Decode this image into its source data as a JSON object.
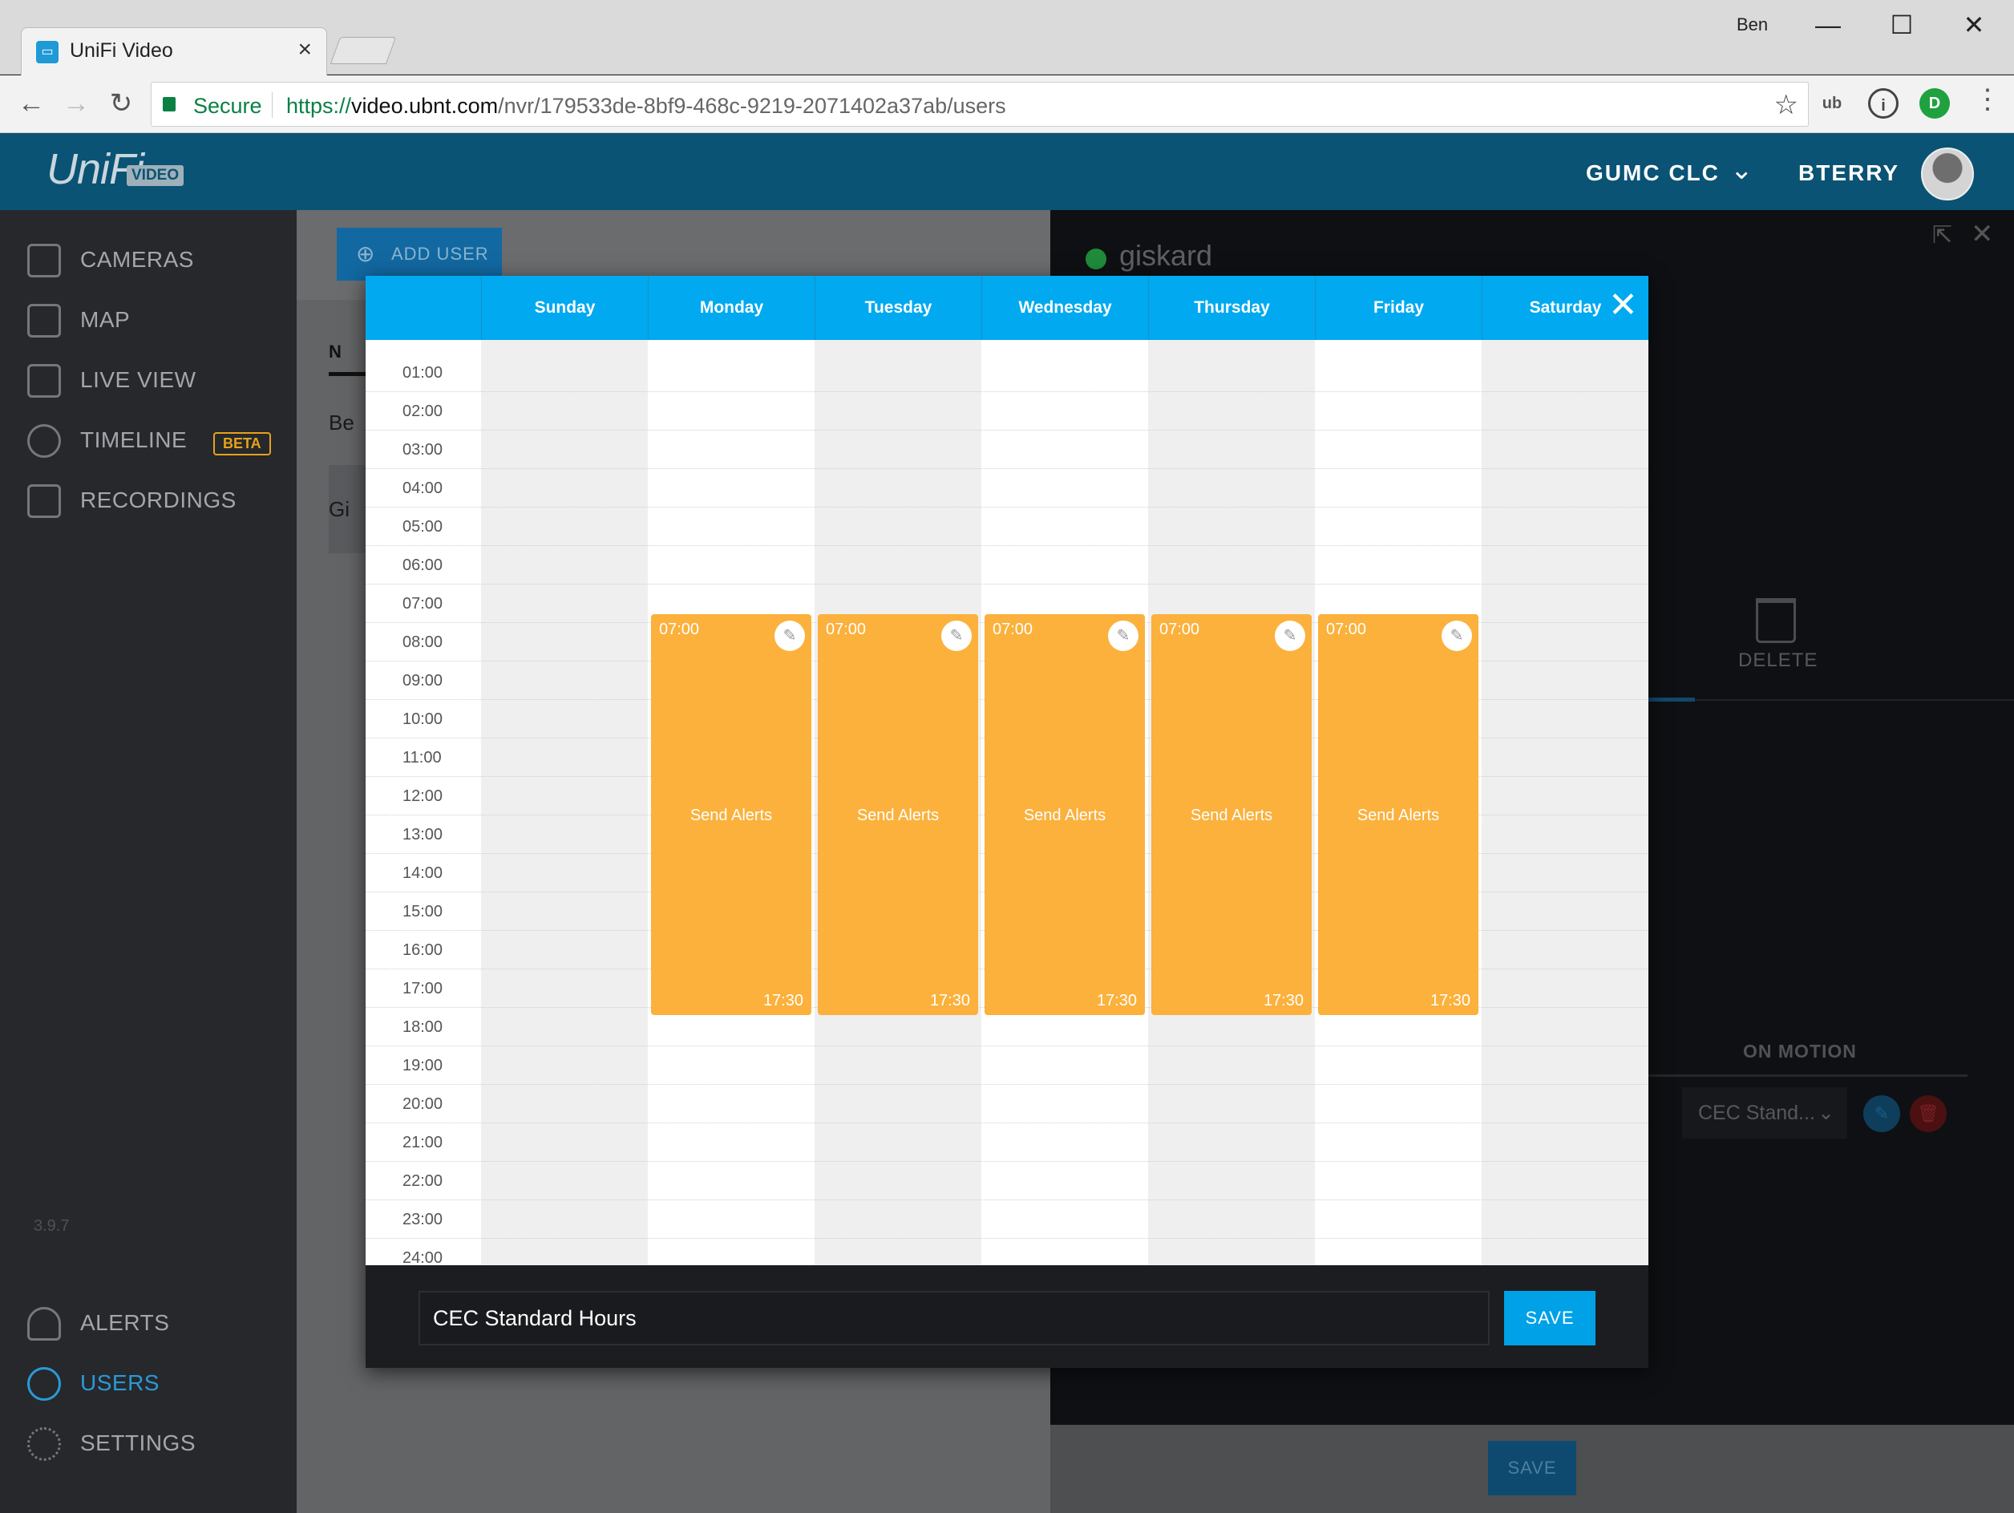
{
  "browser": {
    "tab_title": "UniFi Video",
    "tab_close": "×",
    "profile_name": "Ben",
    "window_controls": {
      "minimize": "—",
      "maximize": "☐",
      "close": "✕"
    },
    "nav": {
      "back": "←",
      "forward": "→",
      "reload": "↻"
    },
    "secure_label": "Secure",
    "url_scheme": "https://",
    "url_host": "video.ubnt.com",
    "url_path": "/nvr/179533de-8bf9-468c-9219-2071402a37ab/users",
    "star": "☆",
    "menu": "⋮",
    "extensions": [
      "ub",
      "i",
      "D"
    ]
  },
  "header": {
    "logo_text": "UniFi",
    "logo_badge": "VIDEO",
    "site_name": "GUMC CLC",
    "site_chevron": "⌄",
    "user_name": "BTERRY"
  },
  "sidebar": {
    "items": [
      {
        "label": "CAMERAS",
        "icon": "camera-icon"
      },
      {
        "label": "MAP",
        "icon": "map-icon"
      },
      {
        "label": "LIVE VIEW",
        "icon": "live-view-icon"
      },
      {
        "label": "TIMELINE",
        "icon": "clock-icon",
        "badge": "BETA"
      },
      {
        "label": "RECORDINGS",
        "icon": "play-icon"
      }
    ],
    "bottom_items": [
      {
        "label": "ALERTS",
        "icon": "bell-icon"
      },
      {
        "label": "USERS",
        "icon": "users-icon",
        "active": true
      },
      {
        "label": "SETTINGS",
        "icon": "gear-icon"
      }
    ],
    "version": "3.9.7"
  },
  "users_list": {
    "add_user_label": "ADD USER",
    "add_icon": "⊕",
    "column_tab": "N",
    "rows": [
      "Be",
      "Gi"
    ]
  },
  "user_panel": {
    "name": "giskard",
    "expand_icon": "⇱",
    "close_icon": "✕",
    "delete_label": "DELETE",
    "on_motion_label": "ON MOTION",
    "schedule_select": "CEC Stand...",
    "select_chevron": "⌄",
    "edit_icon": "✎",
    "trash_icon": "🗑",
    "save_label": "SAVE"
  },
  "schedule_modal": {
    "days": [
      "Sunday",
      "Monday",
      "Tuesday",
      "Wednesday",
      "Thursday",
      "Friday",
      "Saturday"
    ],
    "close_icon": "✕",
    "hours": [
      "01:00",
      "02:00",
      "03:00",
      "04:00",
      "05:00",
      "06:00",
      "07:00",
      "08:00",
      "09:00",
      "10:00",
      "11:00",
      "12:00",
      "13:00",
      "14:00",
      "15:00",
      "16:00",
      "17:00",
      "18:00",
      "19:00",
      "20:00",
      "21:00",
      "22:00",
      "23:00",
      "24:00"
    ],
    "slots": [
      {
        "day": "Monday",
        "start": "07:00",
        "end": "17:30",
        "title": "Send Alerts"
      },
      {
        "day": "Tuesday",
        "start": "07:00",
        "end": "17:30",
        "title": "Send Alerts"
      },
      {
        "day": "Wednesday",
        "start": "07:00",
        "end": "17:30",
        "title": "Send Alerts"
      },
      {
        "day": "Thursday",
        "start": "07:00",
        "end": "17:30",
        "title": "Send Alerts"
      },
      {
        "day": "Friday",
        "start": "07:00",
        "end": "17:30",
        "title": "Send Alerts"
      }
    ],
    "slot_edit_icon": "✎",
    "schedule_name": "CEC Standard Hours",
    "save_label": "SAVE"
  },
  "colors": {
    "header_bg": "#0a5374",
    "modal_header": "#00a9f0",
    "slot": "#fbb13c",
    "active_nav": "#2a9ad6",
    "beta": "#e7a21b",
    "status_online": "#1e8c3a"
  }
}
